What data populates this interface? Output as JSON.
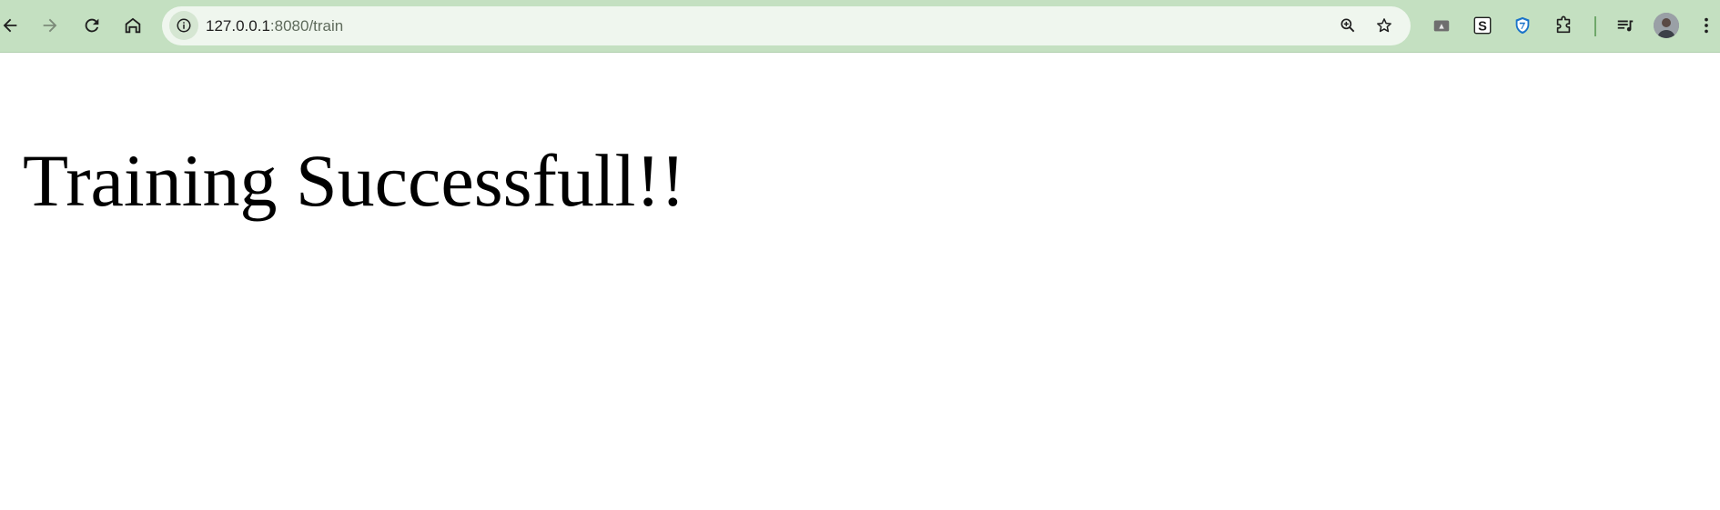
{
  "browser": {
    "url_host": "127.0.0.1",
    "url_path": ":8080/train",
    "toolbar_color": "#c4e0c1",
    "omnibox_color": "#eff6ee",
    "icons": {
      "back": "arrow-left-icon",
      "forward": "arrow-right-icon",
      "reload": "reload-icon",
      "home": "home-icon",
      "site_info": "info-icon",
      "zoom": "zoom-in-icon",
      "bookmark": "star-icon",
      "extensions": [
        "drive-extension-icon",
        "s-extension-icon",
        "shield-extension-icon",
        "puzzle-extensions-icon"
      ],
      "media": "media-queue-icon",
      "profile": "avatar",
      "menu": "kebab-menu-icon"
    },
    "s_extension_letter": "S"
  },
  "page": {
    "heading": "Training Successfull!!"
  }
}
